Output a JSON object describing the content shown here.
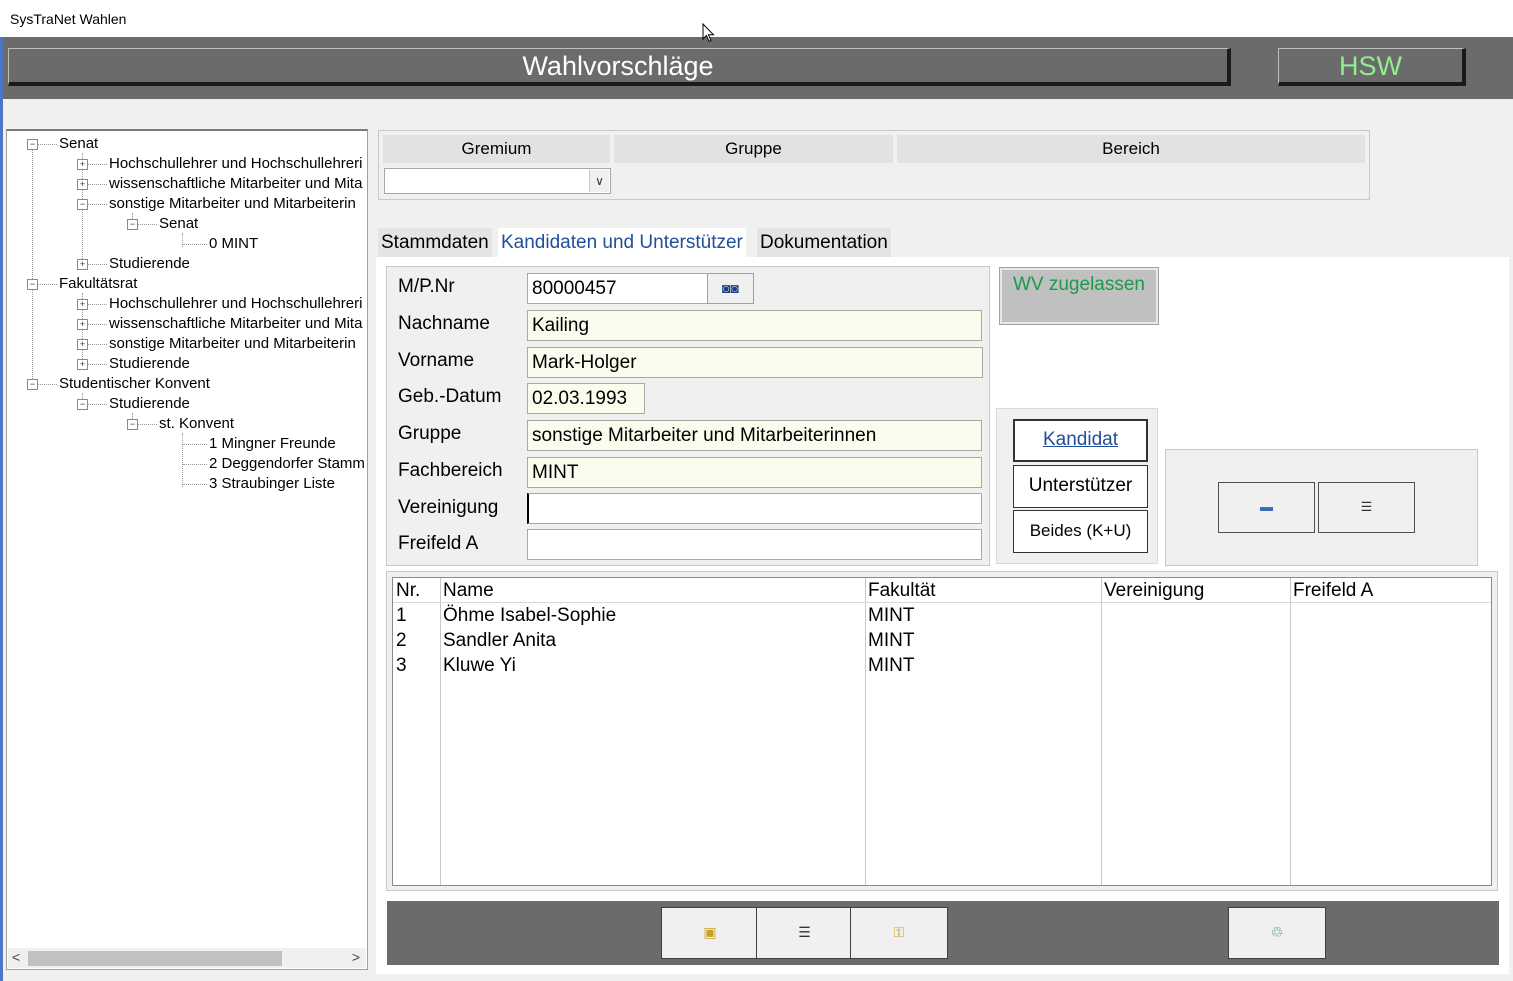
{
  "app": {
    "title": "SysTraNet Wahlen"
  },
  "header": {
    "title": "Wahlvorschläge",
    "org": "HSW"
  },
  "tree": {
    "nodes": [
      {
        "label": "Senat"
      },
      {
        "label": "Hochschullehrer und Hochschullehreri"
      },
      {
        "label": "wissenschaftliche Mitarbeiter und Mita"
      },
      {
        "label": "sonstige Mitarbeiter und Mitarbeiterin"
      },
      {
        "label": "Senat"
      },
      {
        "label": "0 MINT"
      },
      {
        "label": "Studierende"
      },
      {
        "label": "Fakultätsrat"
      },
      {
        "label": "Hochschullehrer und Hochschullehreri"
      },
      {
        "label": "wissenschaftliche Mitarbeiter und Mita"
      },
      {
        "label": "sonstige Mitarbeiter und Mitarbeiterin"
      },
      {
        "label": "Studierende"
      },
      {
        "label": "Studentischer Konvent"
      },
      {
        "label": "Studierende"
      },
      {
        "label": "st. Konvent"
      },
      {
        "label": "1 Mingner Freunde"
      },
      {
        "label": "2 Deggendorfer Stamm"
      },
      {
        "label": "3 Straubinger Liste"
      }
    ]
  },
  "filter": {
    "gremium_label": "Gremium",
    "gruppe_label": "Gruppe",
    "bereich_label": "Bereich",
    "gremium_value": ""
  },
  "tabs": [
    {
      "label": "Stammdaten"
    },
    {
      "label": "Kandidaten und Unterstützer"
    },
    {
      "label": "Dokumentation"
    }
  ],
  "form": {
    "mpnr_label": "M/P.Nr",
    "mpnr_value": "80000457",
    "nachname_label": "Nachname",
    "nachname_value": "Kailing",
    "vorname_label": "Vorname",
    "vorname_value": "Mark-Holger",
    "gebdatum_label": "Geb.-Datum",
    "gebdatum_value": "02.03.1993",
    "gruppe_label": "Gruppe",
    "gruppe_value": "sonstige Mitarbeiter und Mitarbeiterinnen",
    "fachbereich_label": "Fachbereich",
    "fachbereich_value": "MINT",
    "vereinigung_label": "Vereinigung",
    "vereinigung_value": "",
    "freifeld_label": "Freifeld A",
    "freifeld_value": ""
  },
  "buttons": {
    "wv_zugelassen": "WV zugelassen",
    "kandidat": "Kandidat",
    "unterstuetzer": "Unterstützer",
    "beides": "Beides (K+U)"
  },
  "grid": {
    "columns": [
      "Nr.",
      "Name",
      "Fakultät",
      "Vereinigung",
      "Freifeld A"
    ],
    "rows": [
      {
        "nr": "1",
        "name": "Öhme Isabel-Sophie",
        "fakultaet": "MINT",
        "vereinigung": "",
        "freifeld": ""
      },
      {
        "nr": "2",
        "name": "Sandler Anita",
        "fakultaet": "MINT",
        "vereinigung": "",
        "freifeld": ""
      },
      {
        "nr": "3",
        "name": "Kluwe Yi",
        "fakultaet": "MINT",
        "vereinigung": "",
        "freifeld": ""
      }
    ]
  },
  "icons": {
    "search": "binoculars-icon",
    "add": "add-entry-icon",
    "list": "list-edit-icon",
    "lock": "lock-icon",
    "print": "print-list-icon",
    "key": "key-icon",
    "delete": "recycle-bin-icon"
  },
  "colors": {
    "header_bg": "#6b6b6b",
    "title_text": "#ffffff",
    "org_text": "#90ee90",
    "wv_text": "#1a9a4a",
    "active_tab_text": "#1f4e9a",
    "field_yellow": "#fcfcee"
  }
}
